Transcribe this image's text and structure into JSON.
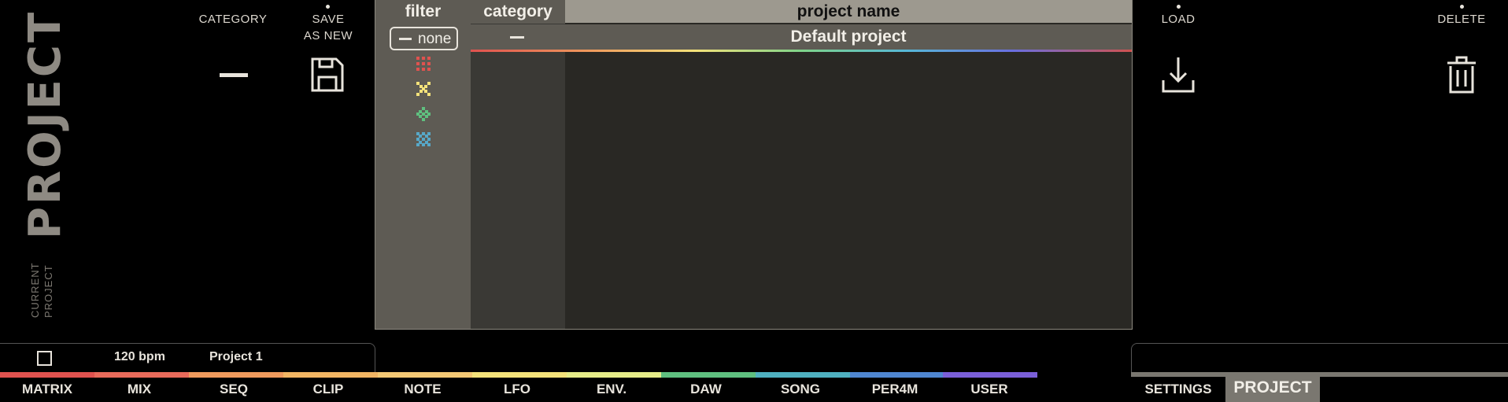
{
  "sidebar": {
    "project_title": "PROJECT 1",
    "subtitle_line1": "CURRENT",
    "subtitle_line2": "PROJECT"
  },
  "controls": {
    "category_label": "CATEGORY",
    "save_label_1": "SAVE",
    "save_label_2": "AS NEW",
    "load_label": "LOAD",
    "delete_label": "DELETE"
  },
  "browser": {
    "headers": {
      "filter": "filter",
      "category": "category",
      "project_name": "project name"
    },
    "filter_none_label": "none",
    "filter_icons": [
      {
        "name": "red-dots-icon",
        "color": "#e0524f"
      },
      {
        "name": "yellow-x-icon",
        "color": "#f4e27a"
      },
      {
        "name": "green-diamond-icon",
        "color": "#5fbf7f"
      },
      {
        "name": "blue-grid-icon",
        "color": "#57a8c8"
      }
    ],
    "rows": [
      {
        "category": "—",
        "name": "Default project"
      }
    ]
  },
  "status": {
    "bpm": "120 bpm",
    "project": "Project 1"
  },
  "tabs": [
    "MATRIX",
    "MIX",
    "SEQ",
    "CLIP",
    "NOTE",
    "LFO",
    "ENV.",
    "DAW",
    "SONG",
    "PER4M",
    "USER"
  ],
  "right_tabs": {
    "settings": "SETTINGS",
    "project": "PROJECT"
  },
  "colors": {
    "matrix": "#e0524f",
    "mix": "#e86a5a",
    "seq": "#ef9a5d",
    "clip": "#f2b563",
    "note": "#f4c874",
    "lfo": "#f4e27a",
    "env": "#e6ec88",
    "daw": "#5fbf7f",
    "song": "#4fb0c0",
    "per4m": "#4f86d0",
    "user": "#7a5fd8"
  }
}
